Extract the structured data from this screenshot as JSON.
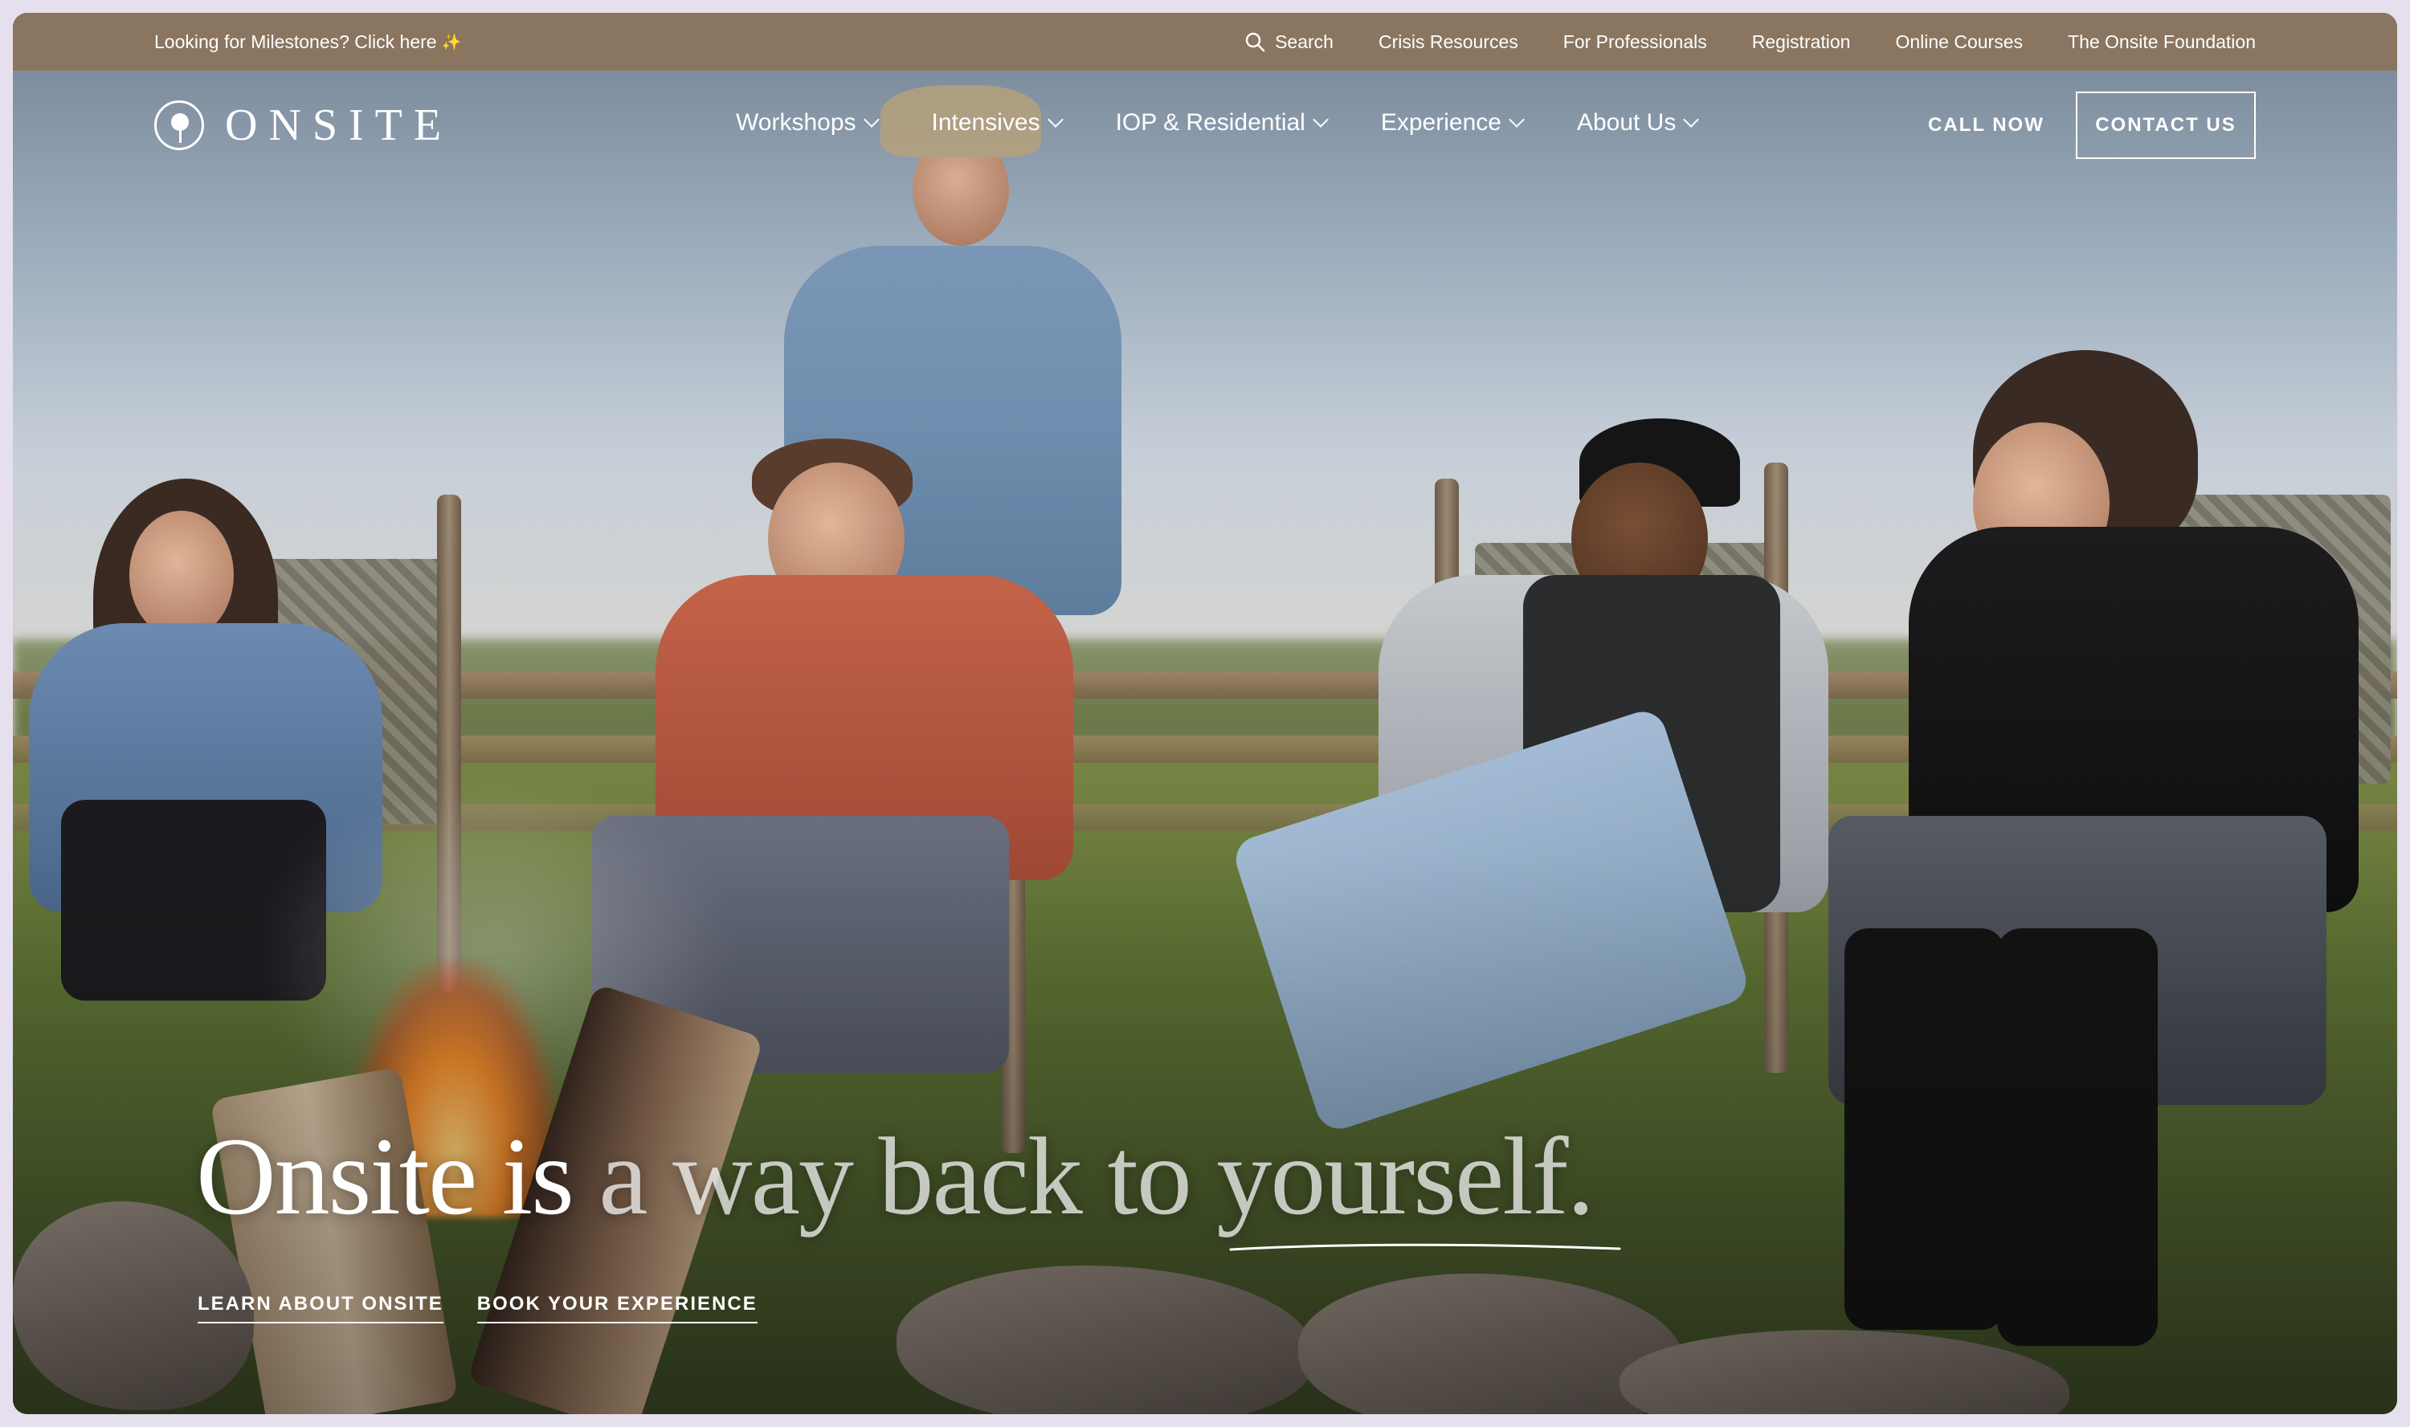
{
  "topbar": {
    "promo_text": "Looking for Milestones? Click here",
    "promo_icon": "sparkle-icon",
    "search_label": "Search",
    "links": [
      "Crisis Resources",
      "For Professionals",
      "Registration",
      "Online Courses",
      "The Onsite Foundation"
    ]
  },
  "brand": {
    "name": "ONSITE",
    "bar_color": "#8a7560"
  },
  "nav": {
    "items": [
      "Workshops",
      "Intensives",
      "IOP & Residential",
      "Experience",
      "About Us"
    ],
    "call_now": "CALL NOW",
    "contact_us": "CONTACT US"
  },
  "hero": {
    "headline_primary": "Onsite is",
    "headline_secondary": "a way back to yourself.",
    "cta_learn": "LEARN ABOUT ONSITE",
    "cta_book": "BOOK YOUR EXPERIENCE"
  }
}
